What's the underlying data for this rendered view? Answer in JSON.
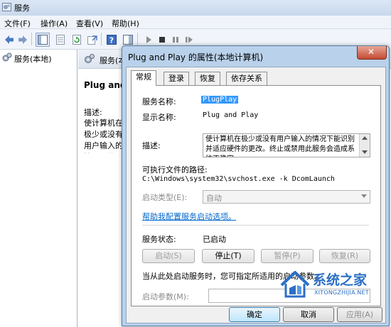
{
  "app": {
    "title": "服务"
  },
  "menu": [
    "文件(F)",
    "操作(A)",
    "查看(V)",
    "帮助(H)"
  ],
  "tree": {
    "root_label": "服务(本地)"
  },
  "right_pane": {
    "header_label": "服务(本地)",
    "service_name": "Plug and",
    "desc_label": "描述:",
    "desc_text": "使计算机在极少或没有用户输入的情况下能识别并适应硬件的更改"
  },
  "dialog": {
    "title": "Plug and Play 的属性(本地计算机)",
    "close_glyph": "✕",
    "tabs": [
      "常规",
      "登录",
      "恢复",
      "依存关系"
    ],
    "active_tab": 0,
    "fields": {
      "service_name_label": "服务名称:",
      "service_name_value": "PlugPlay",
      "display_name_label": "显示名称:",
      "display_name_value": "Plug and Play",
      "description_label": "描述:",
      "description_value": "使计算机在极少或没有用户输入的情况下能识别并适应硬件的更改。终止或禁用此服务会造成系统不稳定。",
      "exe_path_label": "可执行文件的路径:",
      "exe_path_value": "C:\\Windows\\system32\\svchost.exe -k DcomLaunch",
      "startup_type_label": "启动类型(E):",
      "startup_type_value": "自动",
      "help_link": "帮助我配置服务启动选项。",
      "status_label": "服务状态:",
      "status_value": "已启动",
      "start_params_note": "当从此处启动服务时，您可指定所适用的启动参数。",
      "start_params_label": "启动参数(M):"
    },
    "service_buttons": [
      "启动(S)",
      "停止(T)",
      "暂停(P)",
      "恢复(R)"
    ],
    "footer_buttons": {
      "ok": "确定",
      "cancel": "取消",
      "apply": "应用(A)"
    }
  },
  "watermark": {
    "name": "系统之家",
    "url": "XITONGZHIJIA.NET"
  }
}
